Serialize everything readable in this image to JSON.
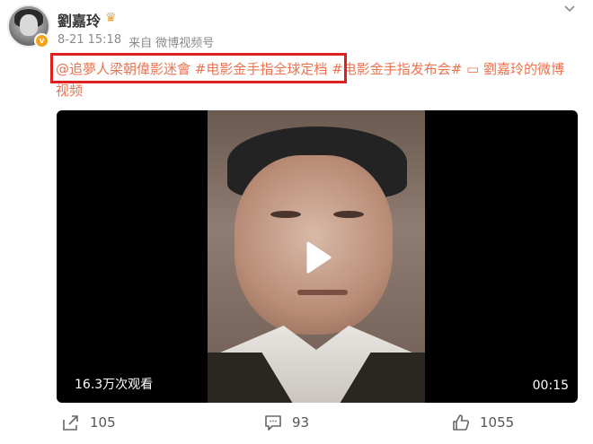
{
  "user": {
    "name": "劉嘉玲",
    "verified_badge": "v",
    "crown_icon": "crown-icon"
  },
  "meta": {
    "time": "8-21 15:18",
    "source": "来自 微博视频号"
  },
  "post": {
    "mention": "@追夢人梁朝偉影迷會",
    "tag1": "#电影金手指全球定档",
    "tag2": "#电影金手指发布会#",
    "link": "劉嘉玲的微博视频"
  },
  "video": {
    "view_count": "16.3万次观看",
    "duration": "00:15"
  },
  "actions": {
    "share_count": "105",
    "comment_count": "93",
    "like_count": "1055"
  },
  "colors": {
    "accent": "#eb7350",
    "highlight": "#e02020"
  }
}
